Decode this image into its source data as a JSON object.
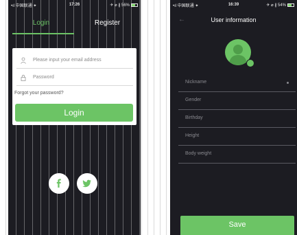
{
  "left_screen": {
    "status": {
      "carrier": "•ıl 中国联通 ✦",
      "time": "17:26",
      "battery_text": "✈ ⌀ ∦ 56%"
    },
    "tabs": {
      "login": "Login",
      "register": "Register"
    },
    "form": {
      "email_placeholder": "Please input your email address",
      "password_placeholder": "Password",
      "forgot": "Forgot your password?",
      "login_button": "Login"
    },
    "social": [
      "facebook",
      "twitter"
    ],
    "colors": {
      "accent": "#6cc465",
      "background": "#1c1c22"
    }
  },
  "right_screen": {
    "status": {
      "carrier": "•ıl 中国联通 ✦",
      "time": "16:39",
      "battery_text": "✈ ⌀ ∦ 54%"
    },
    "title": "User information",
    "fields": [
      "Nickname",
      "Gender",
      "Birthday",
      "Height",
      "Body weight"
    ],
    "save_button": "Save"
  }
}
